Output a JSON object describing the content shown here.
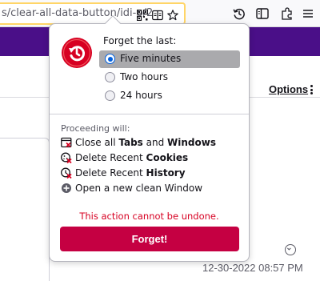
{
  "toolbar": {
    "url_text": "s/clear-all-data-button/idi-p/2",
    "icons": [
      "qr-code-icon",
      "reader-view-icon",
      "bookmark-star-icon",
      "history-icon",
      "sidebar-icon",
      "menu-icon"
    ]
  },
  "page": {
    "options_label": "Options",
    "timestamp": "12-30-2022 08:57 PM"
  },
  "panel": {
    "title": "Forget the last:",
    "options": [
      {
        "label": "Five minutes",
        "selected": true
      },
      {
        "label": "Two hours",
        "selected": false
      },
      {
        "label": "24 hours",
        "selected": false
      }
    ],
    "proceeding_title": "Proceeding will:",
    "effects": [
      {
        "pre": "Close all ",
        "b1": "Tabs",
        "mid": " and ",
        "b2": "Windows",
        "icon": "close-tabs-icon"
      },
      {
        "pre": "Delete Recent ",
        "b1": "Cookies",
        "icon": "cookie-delete-icon"
      },
      {
        "pre": "Delete Recent ",
        "b1": "History",
        "icon": "history-delete-icon"
      },
      {
        "pre": "Open a new clean Window",
        "icon": "plus-circle-icon"
      }
    ],
    "warning": "This action cannot be undone.",
    "forget_button": "Forget!"
  },
  "colors": {
    "accent_blue": "#0060df",
    "forget_button": "#c50042",
    "warning_text": "#d70022",
    "banner": "#4a0f88",
    "urlbar_focus": "#ffd567"
  }
}
